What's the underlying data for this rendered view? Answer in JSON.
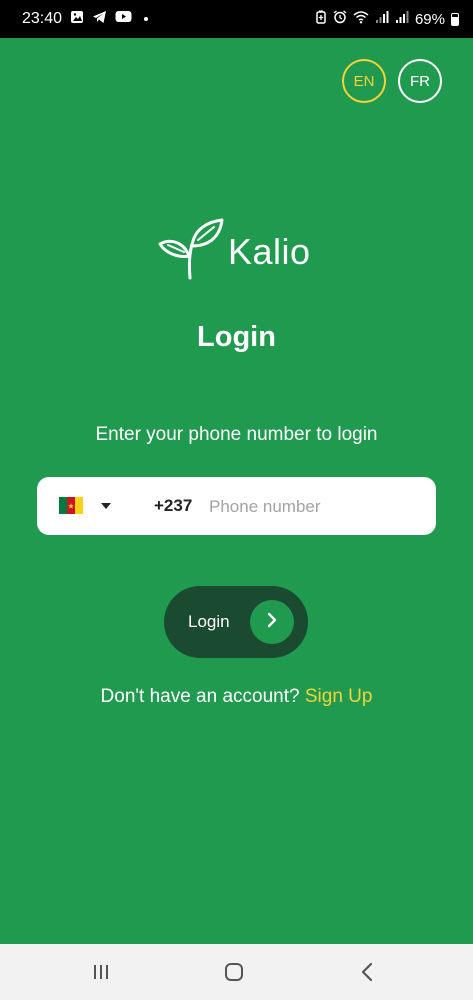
{
  "status_bar": {
    "time": "23:40",
    "battery": "69%",
    "icons": [
      "gallery-icon",
      "telegram-icon",
      "youtube-icon",
      "dot-icon",
      "battery-saver-icon",
      "alarm-icon",
      "wifi-icon",
      "signal-icon",
      "signal-icon",
      "battery-icon"
    ]
  },
  "language": {
    "en_label": "EN",
    "fr_label": "FR",
    "selected": "EN"
  },
  "brand": {
    "name": "Kalio",
    "logo_icon": "leaf-sprout-icon"
  },
  "login": {
    "title": "Login",
    "instruction": "Enter your phone number to login",
    "country_flag": "cameroon-flag-icon",
    "dial_code": "+237",
    "phone_placeholder": "Phone number",
    "phone_value": "",
    "button_label": "Login",
    "button_icon": "chevron-right-icon"
  },
  "signup": {
    "prompt": "Don't have an account?",
    "link_label": "Sign Up"
  },
  "colors": {
    "background": "#1f9a4e",
    "accent_yellow": "#f3d23b",
    "button_dark": "#1a4a2f"
  },
  "nav_bar": {
    "icons": [
      "recent-apps-icon",
      "home-icon",
      "back-icon"
    ]
  }
}
